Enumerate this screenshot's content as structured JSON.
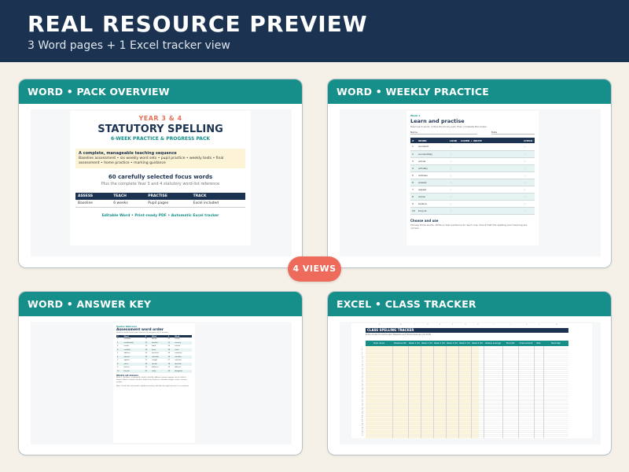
{
  "header": {
    "title": "REAL RESOURCE PREVIEW",
    "subtitle": "3 Word pages + 1 Excel tracker view"
  },
  "badge": "4 VIEWS",
  "cards": {
    "overview": {
      "label": "WORD • PACK OVERVIEW",
      "page": {
        "year": "YEAR 3 & 4",
        "title": "STATUTORY SPELLING",
        "subtitle": "6-WEEK PRACTICE & PROGRESS PACK",
        "note_title": "A complete, manageable teaching sequence",
        "note_body": "Baseline assessment • six weekly word sets • pupil practice • weekly tests • final assessment • home practice • marking guidance",
        "count": "60 carefully selected focus words",
        "plus": "Plus the complete Year 3 and 4 statutory word-list reference",
        "table_headers": [
          "ASSESS",
          "TEACH",
          "PRACTISE",
          "TRACK"
        ],
        "table_row": [
          "Baseline",
          "6 weeks",
          "Pupil pages",
          "Excel included"
        ],
        "footer": "Editable Word • Print-ready PDF • Automatic Excel tracker"
      }
    },
    "practice": {
      "label": "WORD • WEEKLY PRACTICE",
      "page": {
        "week": "Week 1",
        "title": "Learn and practise",
        "instructions": "Read each word, notice the tricky part, then complete the boxes.",
        "name_label": "Name",
        "date_label": "Date",
        "headers": [
          "#",
          "WORD",
          "LOOK",
          "COVER + WRITE",
          "CHECK"
        ],
        "words": [
          "accident",
          "accidentally",
          "actual",
          "actually",
          "address",
          "answer",
          "appear",
          "arrive",
          "believe",
          "bicycle"
        ],
        "choose_title": "Choose and use",
        "choose_text": "Choose three words. Write a clear sentence for each one. Check that the spelling and meaning are correct."
      }
    },
    "answer": {
      "label": "WORD • ANSWER KEY",
      "page": {
        "label": "Teacher Reference",
        "title": "Assessment word order",
        "instructions": "Read the words in this order and use the sentence only if needed.",
        "headers": [
          "#",
          "Word",
          "#",
          "Word",
          "#",
          "Word"
        ],
        "rows": [
          [
            "1",
            "accident",
            "11",
            "breath",
            "21",
            "centre"
          ],
          [
            "2",
            "accidentally",
            "12",
            "breathe",
            "22",
            "century"
          ],
          [
            "3",
            "actual",
            "13",
            "build",
            "23",
            "certain"
          ],
          [
            "4",
            "actually",
            "14",
            "busy",
            "24",
            "circle"
          ],
          [
            "5",
            "address",
            "15",
            "business",
            "25",
            "complete"
          ],
          [
            "6",
            "answer",
            "16",
            "calendar",
            "26",
            "consider"
          ],
          [
            "7",
            "appear",
            "17",
            "caught",
            "27",
            "continue"
          ],
          [
            "8",
            "arrive",
            "18",
            "decide",
            "28",
            "describe"
          ],
          [
            "9",
            "believe",
            "19",
            "different",
            "29",
            "difficult"
          ],
          [
            "10",
            "bicycle",
            "20",
            "early",
            "30",
            "disappear"
          ]
        ],
        "marking_title": "Weekly set answers",
        "marking_text": "Week 1: accident, accidentally, actual, actually, address, answer, appear, arrive, believe, bicycle. Week 2: breath, breathe, build, busy, business, calendar, caught, centre, century, certain.",
        "note": "Note: Check that each word is spelled accurately and that the pupil can use it in a sentence."
      }
    },
    "tracker": {
      "label": "EXCEL • CLASS TRACKER",
      "sheet": {
        "title": "CLASS SPELLING TRACKER",
        "instructions": "Enter scores for each pupil. Baseline and final scores are out of 60.",
        "headers": [
          "Pupil name",
          "Baseline /60",
          "Week 1 /10",
          "Week 2 /10",
          "Week 3 /10",
          "Week 4 /10",
          "Week 5 /10",
          "Week 6 /10",
          "Weekly average /10",
          "Final /60",
          "Improvement",
          "RAG",
          "Next step"
        ]
      }
    }
  }
}
